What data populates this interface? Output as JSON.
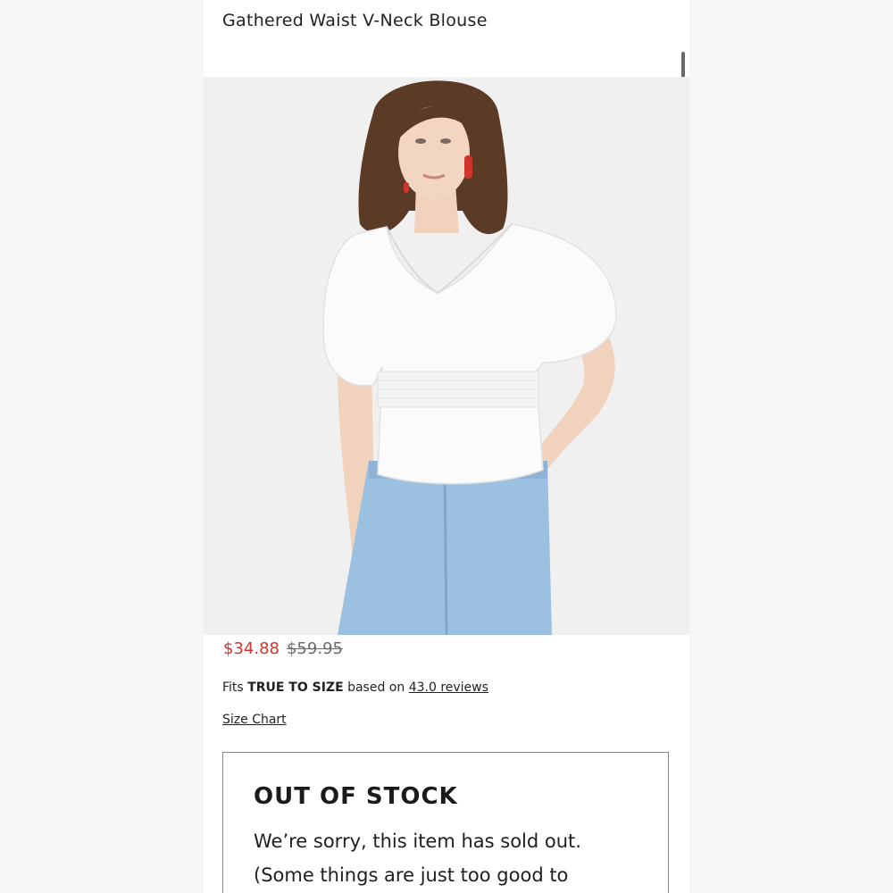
{
  "product": {
    "title": "Gathered Waist V-Neck Blouse",
    "image_alt": "Model wearing white gathered waist v-neck blouse with light wash jeans"
  },
  "pricing": {
    "sale_price": "$34.88",
    "original_price": "$59.95",
    "sale_color": "#d0342c"
  },
  "fit": {
    "prefix": "Fits",
    "fit_label": "TRUE TO SIZE",
    "middle": "based on",
    "reviews_link": "43.0 reviews"
  },
  "size_chart": {
    "label": "Size Chart"
  },
  "stock_notice": {
    "title": "OUT OF STOCK",
    "message": "We’re sorry, this item has sold out. (Some things are just too good to"
  }
}
